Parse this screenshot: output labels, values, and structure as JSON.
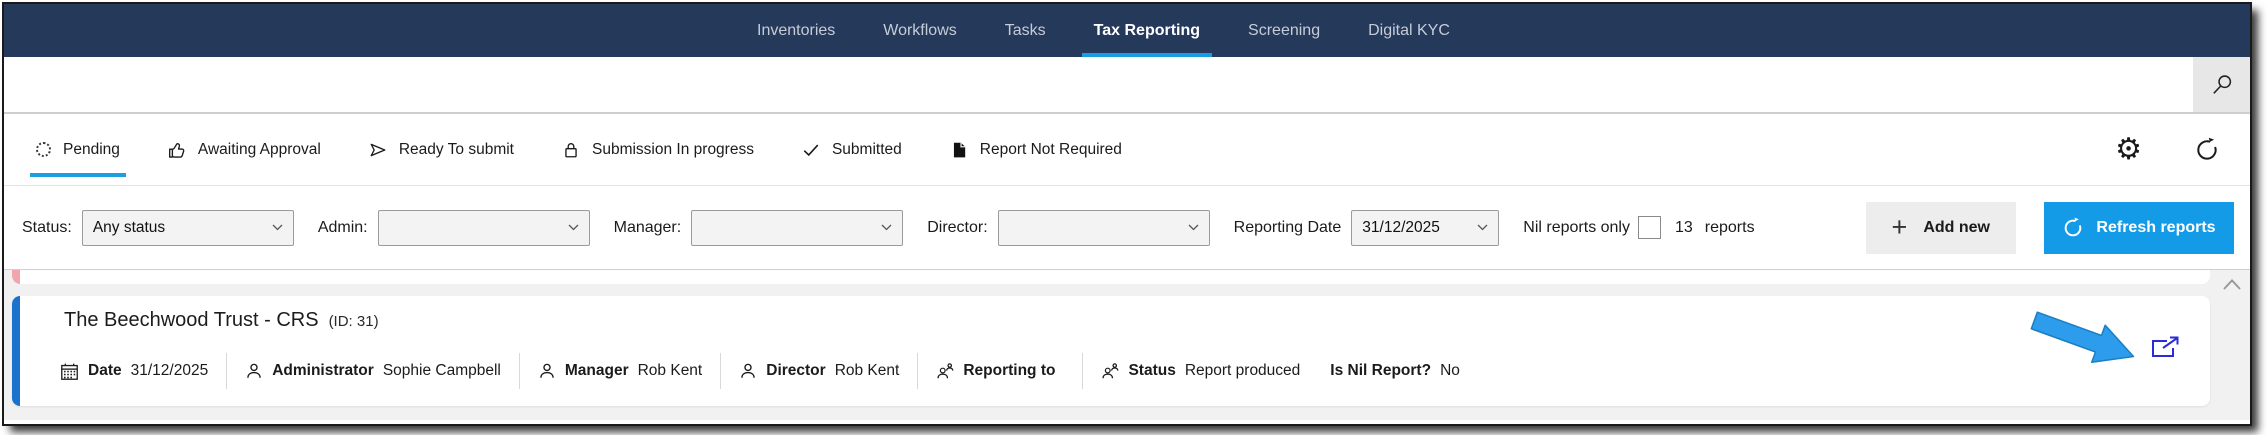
{
  "nav": {
    "items": [
      {
        "label": "Inventories",
        "active": false
      },
      {
        "label": "Workflows",
        "active": false
      },
      {
        "label": "Tasks",
        "active": false
      },
      {
        "label": "Tax Reporting",
        "active": true
      },
      {
        "label": "Screening",
        "active": false
      },
      {
        "label": "Digital KYC",
        "active": false
      }
    ]
  },
  "search": {
    "value": ""
  },
  "tabs": [
    {
      "label": "Pending",
      "icon": "spinner-icon",
      "active": true
    },
    {
      "label": "Awaiting Approval",
      "icon": "thumbs-up-icon",
      "active": false
    },
    {
      "label": "Ready To submit",
      "icon": "send-icon",
      "active": false
    },
    {
      "label": "Submission In progress",
      "icon": "lock-icon",
      "active": false
    },
    {
      "label": "Submitted",
      "icon": "check-icon",
      "active": false
    },
    {
      "label": "Report Not Required",
      "icon": "document-icon",
      "active": false
    }
  ],
  "tab_actions": {
    "settings": "gear-icon",
    "reload": "refresh-icon"
  },
  "filters": {
    "status_label": "Status:",
    "status_value": "Any status",
    "admin_label": "Admin:",
    "admin_value": "",
    "manager_label": "Manager:",
    "manager_value": "",
    "director_label": "Director:",
    "director_value": "",
    "reporting_date_label": "Reporting Date",
    "reporting_date_value": "31/12/2025",
    "nil_reports_label": "Nil reports only",
    "nil_reports_checked": false,
    "report_count": "13",
    "report_count_suffix": "reports",
    "add_new_label": "Add new",
    "refresh_label": "Refresh reports"
  },
  "report_card": {
    "title": "The Beechwood Trust - CRS",
    "id_text": "(ID: 31)",
    "fields": [
      {
        "icon": "calendar-icon",
        "label": "Date",
        "value": "31/12/2025"
      },
      {
        "icon": "person-icon",
        "label": "Administrator",
        "value": "Sophie Campbell"
      },
      {
        "icon": "person-icon",
        "label": "Manager",
        "value": "Rob Kent"
      },
      {
        "icon": "person-icon",
        "label": "Director",
        "value": "Rob Kent"
      },
      {
        "icon": "people-icon",
        "label": "Reporting to",
        "value": ""
      },
      {
        "icon": "people-icon",
        "label": "Status",
        "value": "Report produced"
      },
      {
        "icon": "",
        "label": "Is Nil Report?",
        "value": "No"
      }
    ],
    "open_report_icon": "external-link-icon"
  },
  "annotation": {
    "type": "arrow",
    "color": "#2E9CEC",
    "points_to": "open-report-button"
  },
  "icons": {
    "gear": "⚙",
    "plus": "+",
    "search": "magnifier-outline",
    "refresh": "circular-arrow",
    "spinner": "dotted-circle",
    "thumbs_up": "thumbs-up-outline",
    "send": "arrowhead-right-outline",
    "lock": "padlock-outline",
    "check": "checkmark",
    "document": "filled-page",
    "calendar": "calendar-grid",
    "person": "person-outline",
    "people": "person-with-small-person",
    "external_link": "box-with-arrow-out",
    "scroll_up": "chevron-up"
  },
  "colors": {
    "navbar": "#25395B",
    "nav_inactive_text": "#C6CCD7",
    "accent_blue": "#189DE2",
    "refresh_button": "#149BE8",
    "card_accent": "#1B72CC",
    "prev_card_accent": "#F0A6AC",
    "external_link_icon": "#2B2BD8",
    "list_background": "#F1F1F1"
  }
}
